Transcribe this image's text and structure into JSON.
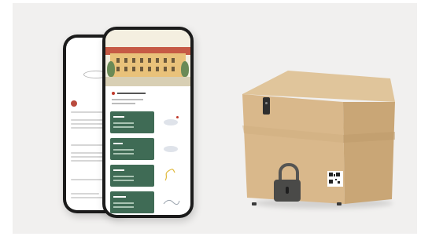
{
  "front_phone": {
    "cards": [
      {
        "icon": "tent-illustration-icon"
      },
      {
        "icon": "tent-illustration-icon"
      },
      {
        "icon": "path-illustration-icon"
      },
      {
        "icon": "map-illustration-icon"
      }
    ]
  },
  "colors": {
    "background": "#f1f0ef",
    "card_green": "#3f6b55",
    "accent_red": "#c0392b",
    "box": "#d8b98a",
    "lock": "#4a4a48"
  }
}
